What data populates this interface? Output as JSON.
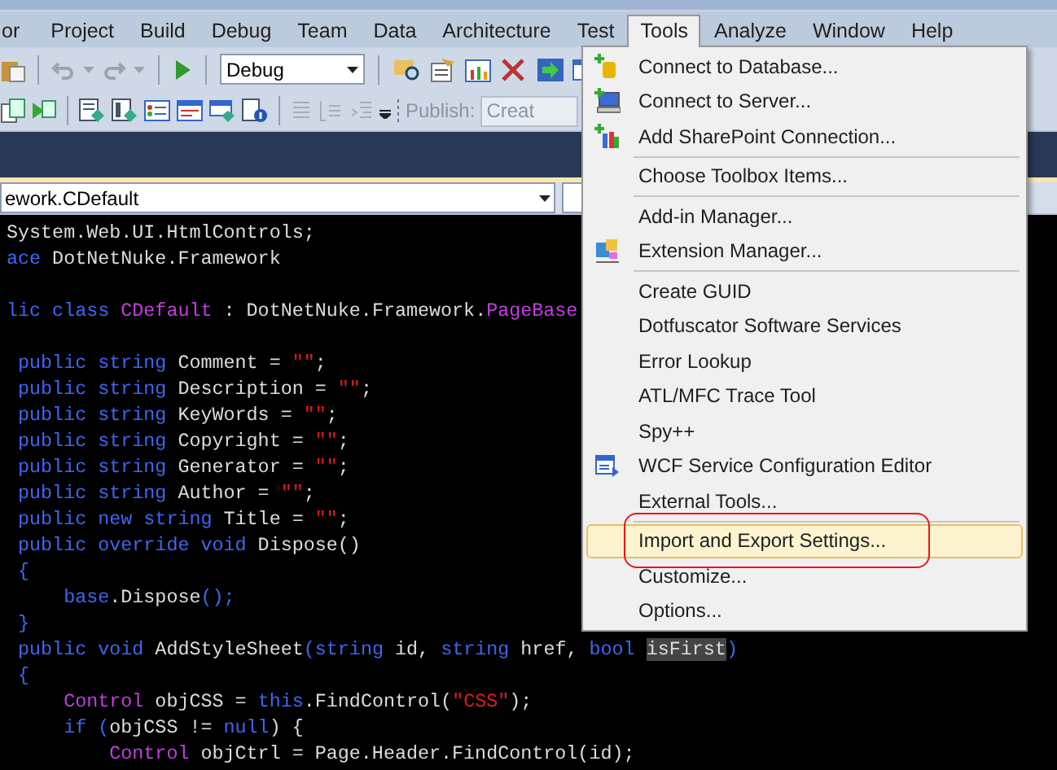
{
  "menubar": [
    {
      "label": "or",
      "selected": false
    },
    {
      "label": "Project",
      "selected": false
    },
    {
      "label": "Build",
      "selected": false
    },
    {
      "label": "Debug",
      "selected": false
    },
    {
      "label": "Team",
      "selected": false
    },
    {
      "label": "Data",
      "selected": false
    },
    {
      "label": "Architecture",
      "selected": false
    },
    {
      "label": "Test",
      "selected": false
    },
    {
      "label": "Tools",
      "selected": true
    },
    {
      "label": "Analyze",
      "selected": false
    },
    {
      "label": "Window",
      "selected": false
    },
    {
      "label": "Help",
      "selected": false
    }
  ],
  "toolbar": {
    "configuration": "Debug",
    "publish_label": "Publish:",
    "publish_value": "Creat"
  },
  "navigation": {
    "type_dropdown": "ework.CDefault"
  },
  "code_lines": [
    {
      "kind": "code",
      "spans": [
        {
          "kind": "plain",
          "text": "System.Web.UI.HtmlControls;"
        }
      ]
    },
    {
      "kind": "code",
      "spans": [
        {
          "kind": "keyword",
          "text": "ace"
        },
        {
          "kind": "plain",
          "text": " DotNetNuke.Framework"
        }
      ]
    },
    {
      "kind": "blank"
    },
    {
      "kind": "code",
      "spans": [
        {
          "kind": "keyword",
          "text": "lic class "
        },
        {
          "kind": "type",
          "text": "CDefault"
        },
        {
          "kind": "plain",
          "text": " : DotNetNuke.Framework."
        },
        {
          "kind": "type",
          "text": "PageBase"
        }
      ]
    },
    {
      "kind": "blank"
    },
    {
      "kind": "code",
      "spans": [
        {
          "kind": "keyword",
          "text": " public string"
        },
        {
          "kind": "plain",
          "text": " Comment = "
        },
        {
          "kind": "string",
          "text": "\"\""
        },
        {
          "kind": "plain",
          "text": ";"
        }
      ]
    },
    {
      "kind": "code",
      "spans": [
        {
          "kind": "keyword",
          "text": " public string"
        },
        {
          "kind": "plain",
          "text": " Description = "
        },
        {
          "kind": "string",
          "text": "\"\""
        },
        {
          "kind": "plain",
          "text": ";"
        }
      ]
    },
    {
      "kind": "code",
      "spans": [
        {
          "kind": "keyword",
          "text": " public string"
        },
        {
          "kind": "plain",
          "text": " KeyWords = "
        },
        {
          "kind": "string",
          "text": "\"\""
        },
        {
          "kind": "plain",
          "text": ";"
        }
      ]
    },
    {
      "kind": "code",
      "spans": [
        {
          "kind": "keyword",
          "text": " public string"
        },
        {
          "kind": "plain",
          "text": " Copyright = "
        },
        {
          "kind": "string",
          "text": "\"\""
        },
        {
          "kind": "plain",
          "text": ";"
        }
      ]
    },
    {
      "kind": "code",
      "spans": [
        {
          "kind": "keyword",
          "text": " public string"
        },
        {
          "kind": "plain",
          "text": " Generator = "
        },
        {
          "kind": "string",
          "text": "\"\""
        },
        {
          "kind": "plain",
          "text": ";"
        }
      ]
    },
    {
      "kind": "code",
      "spans": [
        {
          "kind": "keyword",
          "text": " public string"
        },
        {
          "kind": "plain",
          "text": " Author = "
        },
        {
          "kind": "string",
          "text": "\"\""
        },
        {
          "kind": "plain",
          "text": ";"
        }
      ]
    },
    {
      "kind": "code",
      "spans": [
        {
          "kind": "keyword",
          "text": " public new string"
        },
        {
          "kind": "plain",
          "text": " Title = "
        },
        {
          "kind": "string",
          "text": "\"\""
        },
        {
          "kind": "plain",
          "text": ";"
        }
      ]
    },
    {
      "kind": "code",
      "spans": [
        {
          "kind": "keyword",
          "text": " public override void"
        },
        {
          "kind": "plain",
          "text": " Dispose()"
        }
      ]
    },
    {
      "kind": "code",
      "spans": [
        {
          "kind": "keyword",
          "text": " {"
        }
      ]
    },
    {
      "kind": "code",
      "spans": [
        {
          "kind": "keyword",
          "text": "     base"
        },
        {
          "kind": "plain",
          "text": ".Dispose"
        },
        {
          "kind": "keyword",
          "text": "();"
        }
      ]
    },
    {
      "kind": "code",
      "spans": [
        {
          "kind": "keyword",
          "text": " }"
        }
      ]
    },
    {
      "kind": "code",
      "spans": [
        {
          "kind": "keyword",
          "text": " public void"
        },
        {
          "kind": "plain",
          "text": " AddStyleSheet"
        },
        {
          "kind": "keyword",
          "text": "(string"
        },
        {
          "kind": "plain",
          "text": " id, "
        },
        {
          "kind": "keyword",
          "text": "string"
        },
        {
          "kind": "plain",
          "text": " href, "
        },
        {
          "kind": "keyword",
          "text": "bool "
        },
        {
          "kind": "highlight",
          "text": "isFirst"
        },
        {
          "kind": "keyword",
          "text": ")"
        }
      ]
    },
    {
      "kind": "code",
      "spans": [
        {
          "kind": "keyword",
          "text": " {"
        }
      ]
    },
    {
      "kind": "code",
      "spans": [
        {
          "kind": "type",
          "text": "     Control"
        },
        {
          "kind": "plain",
          "text": " objCSS = "
        },
        {
          "kind": "keyword",
          "text": "this"
        },
        {
          "kind": "plain",
          "text": ".FindControl("
        },
        {
          "kind": "string",
          "text": "\"CSS\""
        },
        {
          "kind": "plain",
          "text": ");"
        }
      ]
    },
    {
      "kind": "code",
      "spans": [
        {
          "kind": "keyword",
          "text": "     if ("
        },
        {
          "kind": "plain",
          "text": "objCSS != "
        },
        {
          "kind": "keyword",
          "text": "null"
        },
        {
          "kind": "plain",
          "text": ") {"
        }
      ]
    },
    {
      "kind": "code",
      "spans": [
        {
          "kind": "type",
          "text": "         Control"
        },
        {
          "kind": "plain",
          "text": " objCtrl = Page.Header.FindControl(id);"
        }
      ]
    }
  ],
  "tools_menu": [
    {
      "kind": "item",
      "label": "Connect to Database...",
      "highlighted": false,
      "circled": false
    },
    {
      "kind": "item",
      "label": "Connect to Server...",
      "highlighted": false,
      "circled": false
    },
    {
      "kind": "item",
      "label": "Add SharePoint Connection...",
      "highlighted": false,
      "circled": false
    },
    {
      "kind": "separator"
    },
    {
      "kind": "item",
      "label": "Choose Toolbox Items...",
      "highlighted": false,
      "circled": false
    },
    {
      "kind": "separator"
    },
    {
      "kind": "item",
      "label": "Add-in Manager...",
      "highlighted": false,
      "circled": false
    },
    {
      "kind": "item",
      "label": "Extension Manager...",
      "highlighted": false,
      "circled": false
    },
    {
      "kind": "separator"
    },
    {
      "kind": "item",
      "label": "Create GUID",
      "highlighted": false,
      "circled": false
    },
    {
      "kind": "item",
      "label": "Dotfuscator Software Services",
      "highlighted": false,
      "circled": false
    },
    {
      "kind": "item",
      "label": "Error Lookup",
      "highlighted": false,
      "circled": false
    },
    {
      "kind": "item",
      "label": "ATL/MFC Trace Tool",
      "highlighted": false,
      "circled": false
    },
    {
      "kind": "item",
      "label": "Spy++",
      "highlighted": false,
      "circled": false
    },
    {
      "kind": "item",
      "label": "WCF Service Configuration Editor",
      "highlighted": false,
      "circled": false
    },
    {
      "kind": "item",
      "label": "External Tools...",
      "highlighted": false,
      "circled": false
    },
    {
      "kind": "separator"
    },
    {
      "kind": "item",
      "label": "Import and Export Settings...",
      "highlighted": true,
      "circled": true
    },
    {
      "kind": "item",
      "label": "Customize...",
      "highlighted": false,
      "circled": false
    },
    {
      "kind": "item",
      "label": "Options...",
      "highlighted": false,
      "circled": false
    }
  ]
}
